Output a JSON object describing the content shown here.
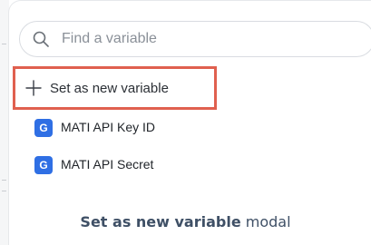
{
  "search": {
    "placeholder": "Find a variable",
    "icon": "search-icon"
  },
  "actions": {
    "set_new_label": "Set as new variable",
    "set_new_icon": "plus-icon",
    "highlight_color": "#e0604f"
  },
  "variables": [
    {
      "badge": "G",
      "label": "MATI API Key ID"
    },
    {
      "badge": "G",
      "label": "MATI API Secret"
    }
  ],
  "colors": {
    "badge_bg": "#2f6fe4",
    "caption_text": "#3f5066"
  },
  "caption": {
    "bold": "Set as new variable",
    "rest": " modal"
  }
}
